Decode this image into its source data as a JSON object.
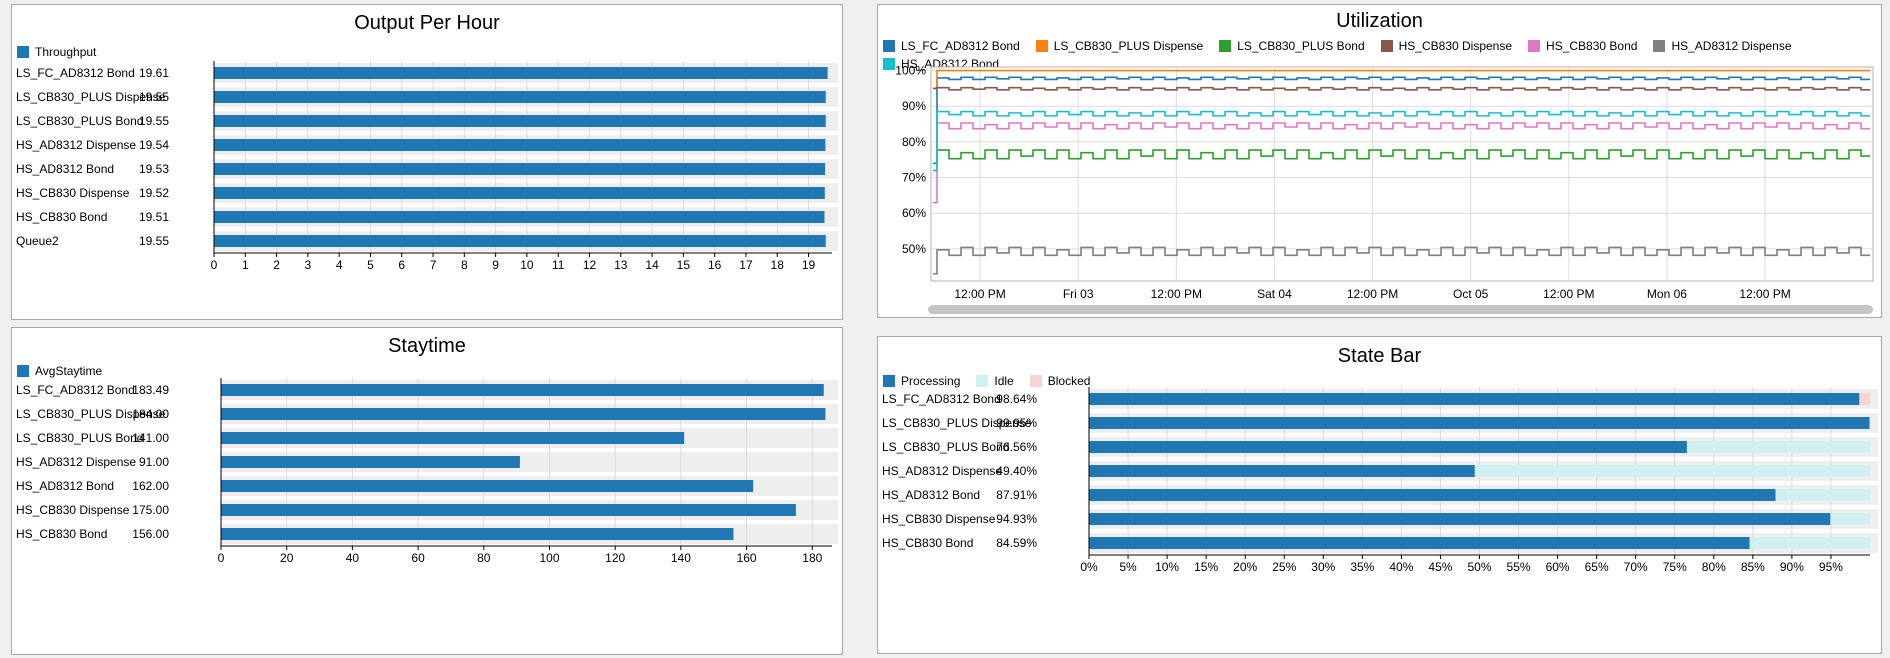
{
  "chart_data": [
    {
      "id": "output",
      "type": "bar",
      "title": "Output Per Hour",
      "legend": [
        {
          "name": "Throughput",
          "color": "#1f77b4"
        }
      ],
      "categories": [
        "LS_FC_AD8312 Bond",
        "LS_CB830_PLUS Dispense",
        "LS_CB830_PLUS Bond",
        "HS_AD8312 Dispense",
        "HS_AD8312 Bond",
        "HS_CB830 Dispense",
        "HS_CB830 Bond",
        "Queue2"
      ],
      "value_labels": [
        "19.61",
        "19.55",
        "19.55",
        "19.54",
        "19.53",
        "19.52",
        "19.51",
        "19.55"
      ],
      "series": [
        {
          "name": "Throughput",
          "values": [
            19.61,
            19.55,
            19.55,
            19.54,
            19.53,
            19.52,
            19.51,
            19.55
          ]
        }
      ],
      "xlim": [
        0,
        19.75
      ],
      "xticks": [
        "0",
        "1",
        "2",
        "3",
        "4",
        "5",
        "6",
        "7",
        "8",
        "9",
        "10",
        "11",
        "12",
        "13",
        "14",
        "15",
        "16",
        "17",
        "18",
        "19"
      ],
      "grid": true,
      "legend_position": "top-left"
    },
    {
      "id": "staytime",
      "type": "bar",
      "title": "Staytime",
      "legend": [
        {
          "name": "AvgStaytime",
          "color": "#1f77b4"
        }
      ],
      "categories": [
        "LS_FC_AD8312 Bond",
        "LS_CB830_PLUS Dispense",
        "LS_CB830_PLUS Bond",
        "HS_AD8312 Dispense",
        "HS_AD8312 Bond",
        "HS_CB830 Dispense",
        "HS_CB830 Bond"
      ],
      "value_labels": [
        "183.49",
        "184.00",
        "141.00",
        "91.00",
        "162.00",
        "175.00",
        "156.00"
      ],
      "series": [
        {
          "name": "AvgStaytime",
          "values": [
            183.49,
            184,
            141,
            91,
            162,
            175,
            156
          ]
        }
      ],
      "xlim": [
        0,
        186
      ],
      "xticks": [
        "0",
        "20",
        "40",
        "60",
        "80",
        "100",
        "120",
        "140",
        "160",
        "180"
      ],
      "grid": true,
      "legend_position": "top-left"
    },
    {
      "id": "utilization",
      "type": "line",
      "title": "Utilization",
      "series": [
        {
          "name": "LS_FC_AD8312 Bond",
          "color": "#1f77b4",
          "level": 97.8,
          "start": 74,
          "amp": 0.3
        },
        {
          "name": "LS_CB830_PLUS Dispense",
          "color": "#ff7f0e",
          "level": 100,
          "start": 95,
          "amp": 0
        },
        {
          "name": "LS_CB830_PLUS Bond",
          "color": "#2ca02c",
          "level": 76.5,
          "start": 74,
          "amp": 1.2
        },
        {
          "name": "HS_CB830 Dispense",
          "color": "#8c564b",
          "level": 94.9,
          "start": 95,
          "amp": 0.3
        },
        {
          "name": "HS_CB830 Bond",
          "color": "#e377c2",
          "level": 84.5,
          "start": 63,
          "amp": 0.8
        },
        {
          "name": "HS_AD8312 Dispense",
          "color": "#7f7f7f",
          "level": 49.3,
          "start": 43,
          "amp": 1.1
        },
        {
          "name": "HS_AD8312 Bond",
          "color": "#17becf",
          "level": 87.9,
          "start": 72,
          "amp": 0.6
        }
      ],
      "ylim": [
        41,
        101
      ],
      "yticks": [
        "50%",
        "60%",
        "70%",
        "80%",
        "90%",
        "100%"
      ],
      "xticks": [
        "12:00 PM",
        "Fri 03",
        "12:00 PM",
        "Sat 04",
        "12:00 PM",
        "Oct 05",
        "12:00 PM",
        "Mon 06",
        "12:00 PM"
      ],
      "grid": true,
      "legend_position": "top"
    },
    {
      "id": "statebar",
      "type": "bar",
      "stacked": true,
      "title": "State Bar",
      "legend": [
        {
          "name": "Processing",
          "color": "#1f77b4"
        },
        {
          "name": "Idle",
          "color": "#d0f0f2"
        },
        {
          "name": "Blocked",
          "color": "#f8d4d4"
        }
      ],
      "categories": [
        "LS_FC_AD8312 Bond",
        "LS_CB830_PLUS Dispense",
        "LS_CB830_PLUS Bond",
        "HS_AD8312 Dispense",
        "HS_AD8312 Bond",
        "HS_CB830 Dispense",
        "HS_CB830 Bond"
      ],
      "value_labels": [
        "98.64%",
        "99.95%",
        "76.56%",
        "49.40%",
        "87.91%",
        "94.93%",
        "84.59%"
      ],
      "series": [
        {
          "name": "Processing",
          "values": [
            98.64,
            99.95,
            76.56,
            49.4,
            87.91,
            94.93,
            84.59
          ]
        },
        {
          "name": "Idle",
          "values": [
            0,
            0.05,
            23.44,
            50.6,
            12.09,
            5.07,
            15.41
          ]
        },
        {
          "name": "Blocked",
          "values": [
            1.36,
            0,
            0,
            0,
            0,
            0,
            0
          ]
        }
      ],
      "xlim": [
        0,
        100
      ],
      "xticks": [
        "0%",
        "5%",
        "10%",
        "15%",
        "20%",
        "25%",
        "30%",
        "35%",
        "40%",
        "45%",
        "50%",
        "55%",
        "60%",
        "65%",
        "70%",
        "75%",
        "80%",
        "85%",
        "90%",
        "95%"
      ],
      "grid": true,
      "legend_position": "top-left"
    }
  ]
}
